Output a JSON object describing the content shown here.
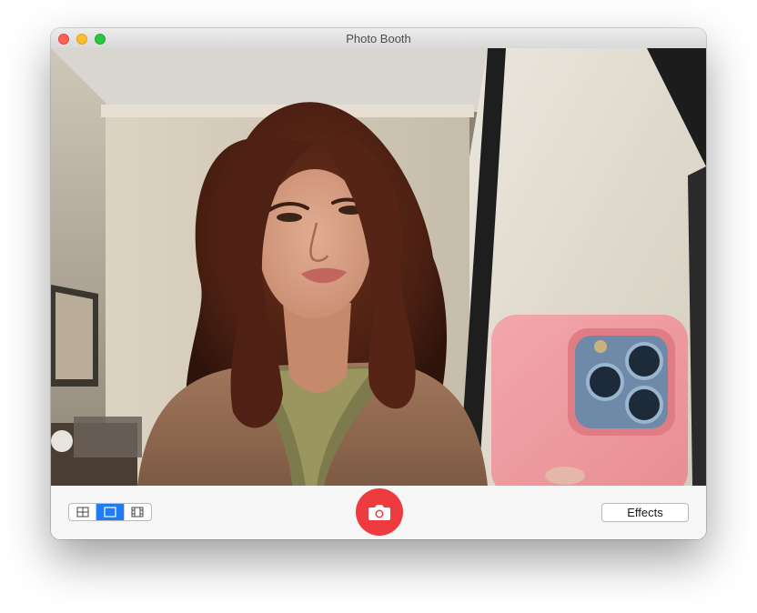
{
  "window": {
    "title": "Photo Booth"
  },
  "toolbar": {
    "view_modes": [
      {
        "name": "four-up-grid",
        "icon": "grid-icon",
        "selected": false
      },
      {
        "name": "single-photo",
        "icon": "single-frame-icon",
        "selected": true
      },
      {
        "name": "video",
        "icon": "filmstrip-icon",
        "selected": false
      }
    ],
    "shutter_icon": "camera-icon",
    "effects_label": "Effects"
  },
  "colors": {
    "accent": "#1f7cf5",
    "shutter": "#ee3b40"
  }
}
